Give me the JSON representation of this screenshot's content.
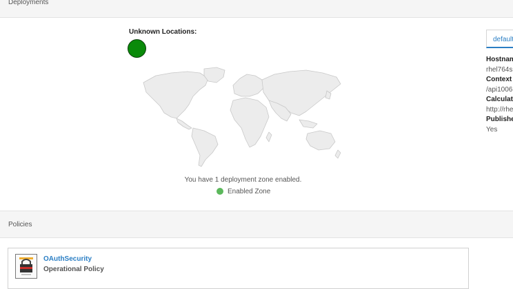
{
  "deployments": {
    "title": "Deployments",
    "unknown_locations_label": "Unknown Locations:",
    "zone_message": "You have 1 deployment zone enabled.",
    "legend_label": "Enabled Zone",
    "colors": {
      "unknown_dot": "#0a8a0a",
      "enabled_zone": "#5cb85c",
      "map_fill": "#ececec",
      "map_stroke": "#c8c8c8"
    },
    "side_panel": {
      "tab_label": "default",
      "fields": [
        {
          "label": "Hostnam",
          "value": "rhel764s"
        },
        {
          "label": "Context I",
          "value": "/api1006"
        },
        {
          "label": "Calculate",
          "value": "http://rhe"
        },
        {
          "label": "Publishe",
          "value": "Yes"
        }
      ]
    }
  },
  "policies": {
    "title": "Policies",
    "items": [
      {
        "name": "OAuthSecurity",
        "type": "Operational Policy",
        "icon": "policy-lock-icon"
      }
    ]
  },
  "accent_color": "#2a7ec4"
}
